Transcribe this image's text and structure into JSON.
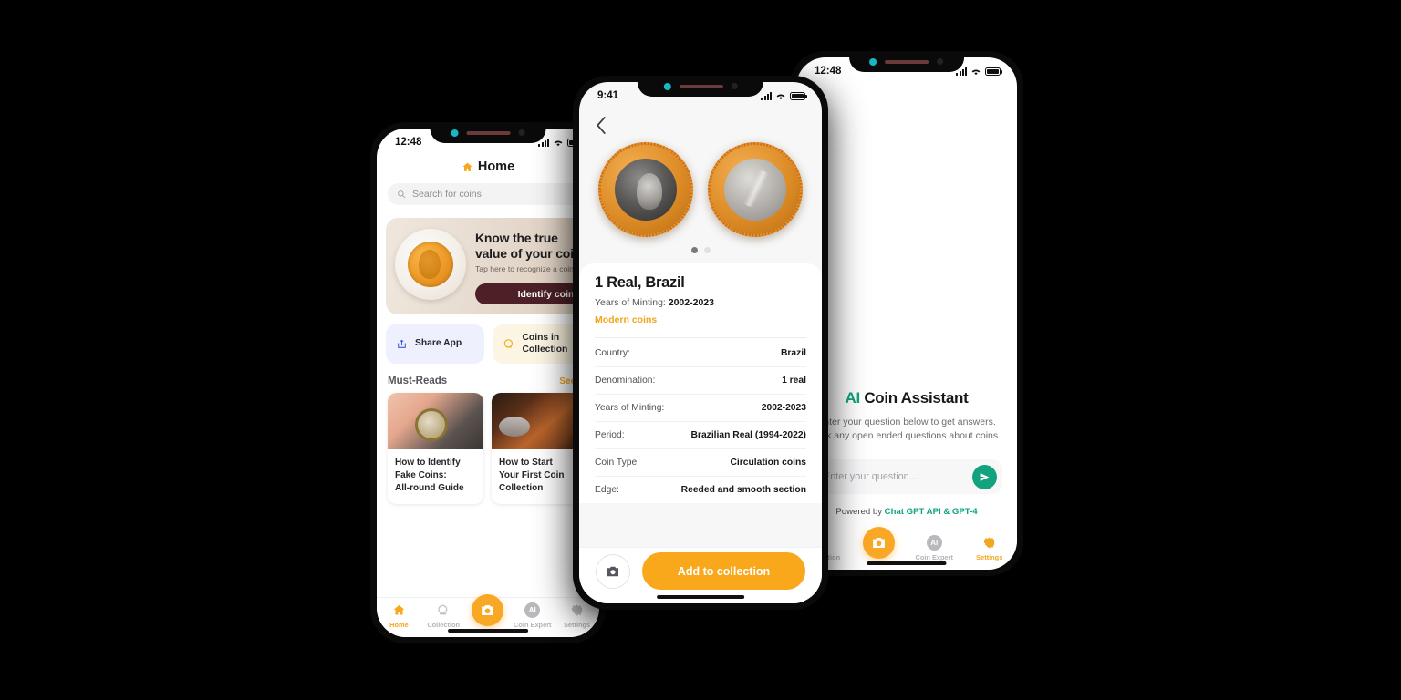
{
  "left_phone": {
    "status": {
      "time": "12:48",
      "signal_icon": "cellular-bars-icon",
      "wifi_icon": "wifi-icon",
      "battery_icon": "battery-icon"
    },
    "header": {
      "title": "Home",
      "icon": "home-icon"
    },
    "search": {
      "placeholder": "Search for coins",
      "icon": "search-icon"
    },
    "banner": {
      "headline_line1": "Know the true",
      "headline_line2": "value of your coin",
      "subtext": "Tap here to recognize a coin",
      "cta": "Identify coin",
      "cta_color": "#4c2026",
      "image": "gold-coin-on-plate-image"
    },
    "chips": [
      {
        "label": "Share App",
        "icon": "share-icon",
        "bg": "#eef0fd"
      },
      {
        "label_line1": "Coins in",
        "label_line2": "Collection",
        "icon": "coin-stack-icon",
        "bg": "#fdf5e3"
      }
    ],
    "must_reads": {
      "heading": "Must-Reads",
      "see_all": "See all"
    },
    "articles": [
      {
        "title_line1": "How to Identify",
        "title_line2": "Fake Coins:",
        "title_line3": "All-round Guide",
        "image": "hand-holding-coins-magnifier-image"
      },
      {
        "title_line1": "How to Start",
        "title_line2": "Your First Coin",
        "title_line3": "Collection",
        "image": "stacked-copper-coins-image"
      }
    ],
    "tabs": [
      {
        "label": "Home",
        "icon": "home-icon",
        "active": true
      },
      {
        "label": "Collection",
        "icon": "collection-icon",
        "active": false
      },
      {
        "label": "",
        "icon": "camera-icon",
        "active": false,
        "fab": true
      },
      {
        "label": "Coin Expert",
        "icon": "ai-icon",
        "active": false
      },
      {
        "label": "Settings",
        "icon": "gear-icon",
        "active": false
      }
    ]
  },
  "center_phone": {
    "status": {
      "time": "9:41",
      "signal_icon": "cellular-bars-icon",
      "wifi_icon": "wifi-icon",
      "battery_icon": "battery-icon"
    },
    "back_icon": "chevron-left-icon",
    "gallery": {
      "images": [
        "brazil-1-real-obverse-image",
        "brazil-1-real-reverse-image"
      ],
      "dots": 2,
      "active_dot": 1
    },
    "title": "1 Real, Brazil",
    "subtitle_label": "Years of Minting:",
    "subtitle_value": "2002-2023",
    "tag": "Modern coins",
    "tag_color": "#f2a51e",
    "details": [
      {
        "key": "Country:",
        "value": "Brazil"
      },
      {
        "key": "Denomination:",
        "value": "1 real"
      },
      {
        "key": "Years of Minting:",
        "value": "2002-2023"
      },
      {
        "key": "Period:",
        "value": "Brazilian Real (1994-2022)"
      },
      {
        "key": "Coin Type:",
        "value": "Circulation coins"
      },
      {
        "key": "Edge:",
        "value": "Reeded and smooth section"
      }
    ],
    "actions": {
      "camera_icon": "camera-icon",
      "add_label": "Add to collection",
      "add_color": "#f9a81c"
    }
  },
  "right_phone": {
    "status": {
      "time": "12:48",
      "signal_icon": "cellular-bars-icon",
      "wifi_icon": "wifi-icon",
      "battery_icon": "battery-icon"
    },
    "heading_accent": "AI",
    "heading_rest": " Coin Assistant",
    "subtext_line1": "Enter your question below to get answers. Ask any open",
    "subtext_line2": "ended questions about coins",
    "input_placeholder": "Enter your question...",
    "send_icon": "send-icon",
    "send_color": "#12a37e",
    "powered_prefix": "Powered by ",
    "powered_brand": "Chat GPT API & GPT-4",
    "tabs": [
      {
        "label": "Collection",
        "icon": "collection-icon",
        "active": false
      },
      {
        "label": "",
        "icon": "camera-icon",
        "active": false,
        "fab": true
      },
      {
        "label": "Coin Expert",
        "icon": "ai-icon",
        "active": false
      },
      {
        "label": "Settings",
        "icon": "gear-icon",
        "active": true
      }
    ]
  }
}
